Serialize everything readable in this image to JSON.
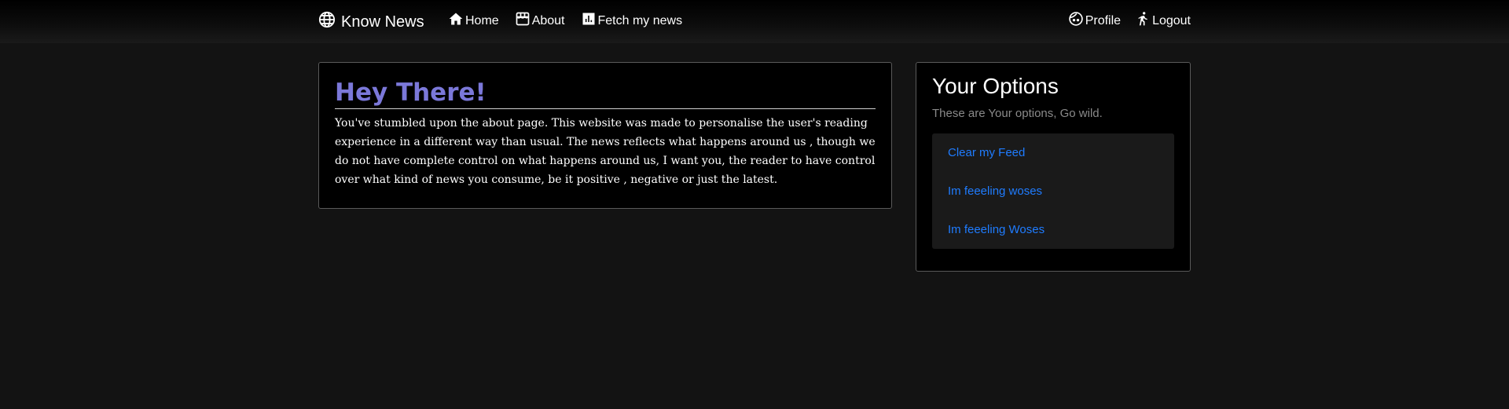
{
  "navbar": {
    "brand_label": "Know News",
    "brand_icon": "globe-icon",
    "links": [
      {
        "label": "Home",
        "icon": "home-icon"
      },
      {
        "label": "About",
        "icon": "store-icon"
      },
      {
        "label": "Fetch my news",
        "icon": "chart-icon"
      }
    ],
    "right_links": [
      {
        "label": "Profile",
        "icon": "face-icon"
      },
      {
        "label": "Logout",
        "icon": "running-person-icon"
      }
    ]
  },
  "about": {
    "title": "Hey There!",
    "body": "You've stumbled upon the about page. This website was made to personalise the user's reading experience in a different way than usual. The news reflects what happens around us , though we do not have complete control on what happens around us, I want you, the reader to have control over what kind of news you consume, be it positive , negative or just the latest."
  },
  "options": {
    "title": "Your Options",
    "subtitle": "These are Your options, Go wild.",
    "items": [
      {
        "label": "Clear my Feed"
      },
      {
        "label": "Im feeeling woses"
      },
      {
        "label": "Im feeeling Woses"
      }
    ]
  },
  "colors": {
    "background": "#131313",
    "card": "#000000",
    "title_accent": "#7b78d9",
    "link": "#1f7cff",
    "muted_text": "#8a8a8a"
  }
}
